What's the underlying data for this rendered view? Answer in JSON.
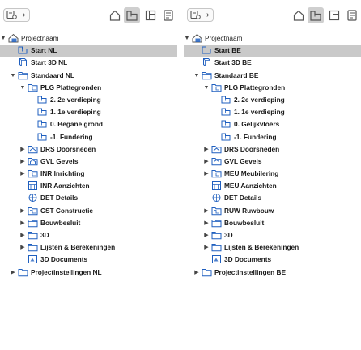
{
  "panels": [
    {
      "id": "left",
      "nav_chevron": "›",
      "toolbar_icons": [
        "project-map-icon",
        "view-map-icon",
        "layout-book-icon",
        "publisher-icon"
      ],
      "active_toolbar": 1,
      "rows": [
        {
          "label": "Projectnaam",
          "level": 0,
          "arrow": "▼",
          "icon": "project-icon"
        },
        {
          "label": "Start NL",
          "level": 1,
          "arrow": "",
          "icon": "plan-view-icon",
          "selected": true
        },
        {
          "label": "Start 3D NL",
          "level": 1,
          "arrow": "",
          "icon": "3d-view-icon"
        },
        {
          "label": "Standaard NL",
          "level": 1,
          "arrow": "▼",
          "icon": "folder-icon"
        },
        {
          "label": "PLG Plattegronden",
          "level": 2,
          "arrow": "▼",
          "icon": "plan-folder-icon"
        },
        {
          "label": "2. 2e verdieping",
          "level": 3,
          "arrow": "",
          "icon": "plan-view-icon"
        },
        {
          "label": "1. 1e verdieping",
          "level": 3,
          "arrow": "",
          "icon": "plan-view-icon"
        },
        {
          "label": "0. Begane grond",
          "level": 3,
          "arrow": "",
          "icon": "plan-view-icon"
        },
        {
          "label": "-1. Fundering",
          "level": 3,
          "arrow": "",
          "icon": "plan-view-icon"
        },
        {
          "label": "DRS Doorsneden",
          "level": 2,
          "arrow": "▶",
          "icon": "section-folder-icon"
        },
        {
          "label": "GVL Gevels",
          "level": 2,
          "arrow": "▶",
          "icon": "elevation-folder-icon"
        },
        {
          "label": "INR Inrichting",
          "level": 2,
          "arrow": "▶",
          "icon": "plan-folder-icon"
        },
        {
          "label": "INR Aanzichten",
          "level": 2,
          "arrow": "",
          "icon": "interior-elevation-icon"
        },
        {
          "label": "DET Details",
          "level": 2,
          "arrow": "",
          "icon": "detail-icon"
        },
        {
          "label": "CST Constructie",
          "level": 2,
          "arrow": "▶",
          "icon": "plan-folder-icon"
        },
        {
          "label": "Bouwbesluit",
          "level": 2,
          "arrow": "▶",
          "icon": "folder-icon"
        },
        {
          "label": "3D",
          "level": 2,
          "arrow": "▶",
          "icon": "folder-icon"
        },
        {
          "label": "Lijsten & Berekeningen",
          "level": 2,
          "arrow": "▶",
          "icon": "folder-icon"
        },
        {
          "label": "3D Documents",
          "level": 2,
          "arrow": "",
          "icon": "3d-document-icon"
        },
        {
          "label": "Projectinstellingen NL",
          "level": 1,
          "arrow": "▶",
          "icon": "folder-icon"
        }
      ]
    },
    {
      "id": "right",
      "nav_chevron": "›",
      "toolbar_icons": [
        "project-map-icon",
        "view-map-icon",
        "layout-book-icon",
        "publisher-icon"
      ],
      "active_toolbar": 1,
      "rows": [
        {
          "label": "Projectnaam",
          "level": 0,
          "arrow": "▼",
          "icon": "project-icon"
        },
        {
          "label": "Start BE",
          "level": 1,
          "arrow": "",
          "icon": "plan-view-icon",
          "selected": true
        },
        {
          "label": "Start 3D BE",
          "level": 1,
          "arrow": "",
          "icon": "3d-view-icon"
        },
        {
          "label": "Standaard BE",
          "level": 1,
          "arrow": "▼",
          "icon": "folder-icon"
        },
        {
          "label": "PLG Plattegronden",
          "level": 2,
          "arrow": "▼",
          "icon": "plan-folder-icon"
        },
        {
          "label": "2. 2e verdieping",
          "level": 3,
          "arrow": "",
          "icon": "plan-view-icon"
        },
        {
          "label": "1. 1e verdieping",
          "level": 3,
          "arrow": "",
          "icon": "plan-view-icon"
        },
        {
          "label": "0. Gelijkvloers",
          "level": 3,
          "arrow": "",
          "icon": "plan-view-icon"
        },
        {
          "label": "-1. Fundering",
          "level": 3,
          "arrow": "",
          "icon": "plan-view-icon"
        },
        {
          "label": "DRS Doorsneden",
          "level": 2,
          "arrow": "▶",
          "icon": "section-folder-icon"
        },
        {
          "label": "GVL Gevels",
          "level": 2,
          "arrow": "▶",
          "icon": "elevation-folder-icon"
        },
        {
          "label": "MEU Meubilering",
          "level": 2,
          "arrow": "▶",
          "icon": "plan-folder-icon"
        },
        {
          "label": "MEU Aanzichten",
          "level": 2,
          "arrow": "",
          "icon": "interior-elevation-icon"
        },
        {
          "label": "DET Details",
          "level": 2,
          "arrow": "",
          "icon": "detail-icon"
        },
        {
          "label": "RUW Ruwbouw",
          "level": 2,
          "arrow": "▶",
          "icon": "plan-folder-icon"
        },
        {
          "label": "Bouwbesluit",
          "level": 2,
          "arrow": "▶",
          "icon": "folder-icon"
        },
        {
          "label": "3D",
          "level": 2,
          "arrow": "▶",
          "icon": "folder-icon"
        },
        {
          "label": "Lijsten & Berekeningen",
          "level": 2,
          "arrow": "▶",
          "icon": "folder-icon"
        },
        {
          "label": "3D Documents",
          "level": 2,
          "arrow": "",
          "icon": "3d-document-icon"
        },
        {
          "label": "Projectinstellingen BE",
          "level": 1,
          "arrow": "▶",
          "icon": "folder-icon"
        }
      ]
    }
  ],
  "colors": {
    "icon_blue": "#1f5fbf",
    "selection": "#c9c9c9",
    "toolbar_active": "#cfcfcf",
    "icon_gray": "#555555"
  }
}
